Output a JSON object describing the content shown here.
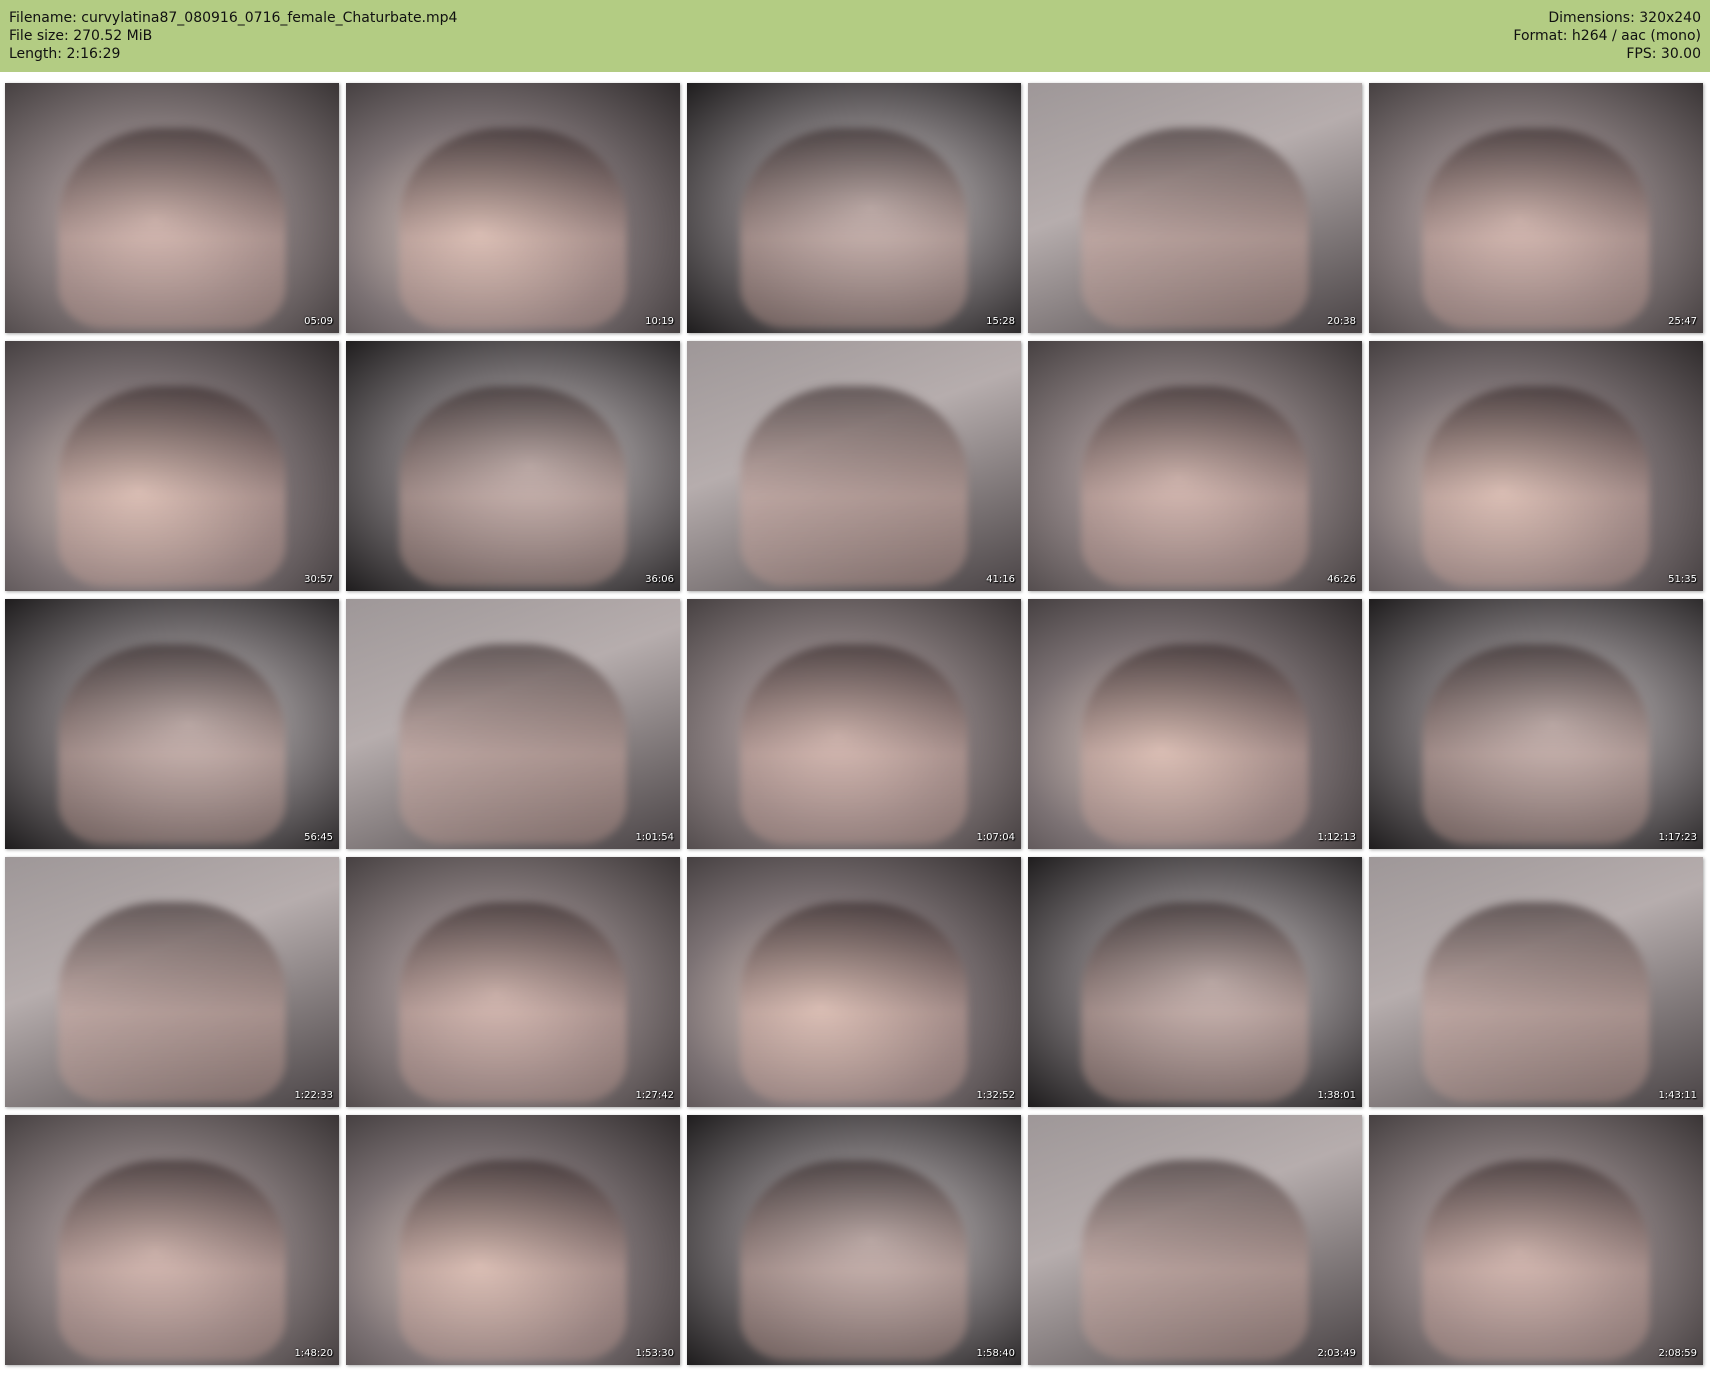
{
  "header": {
    "filename_line": "Filename: curvylatina87_080916_0716_female_Chaturbate.mp4",
    "filesize_line": "File size: 270.52 MiB",
    "length_line": "Length: 2:16:29",
    "dimensions_line": "Dimensions: 320x240",
    "format_line": "Format: h264 / aac (mono)",
    "fps_line": "FPS: 30.00"
  },
  "colors": {
    "header_background": "#b3cc83",
    "page_background": "#ffffff",
    "timestamp_text": "#ffffff"
  },
  "thumbnails": [
    {
      "time": "05:09"
    },
    {
      "time": "10:19"
    },
    {
      "time": "15:28"
    },
    {
      "time": "20:38"
    },
    {
      "time": "25:47"
    },
    {
      "time": "30:57"
    },
    {
      "time": "36:06"
    },
    {
      "time": "41:16"
    },
    {
      "time": "46:26"
    },
    {
      "time": "51:35"
    },
    {
      "time": "56:45"
    },
    {
      "time": "1:01:54"
    },
    {
      "time": "1:07:04"
    },
    {
      "time": "1:12:13"
    },
    {
      "time": "1:17:23"
    },
    {
      "time": "1:22:33"
    },
    {
      "time": "1:27:42"
    },
    {
      "time": "1:32:52"
    },
    {
      "time": "1:38:01"
    },
    {
      "time": "1:43:11"
    },
    {
      "time": "1:48:20"
    },
    {
      "time": "1:53:30"
    },
    {
      "time": "1:58:40"
    },
    {
      "time": "2:03:49"
    },
    {
      "time": "2:08:59"
    }
  ]
}
